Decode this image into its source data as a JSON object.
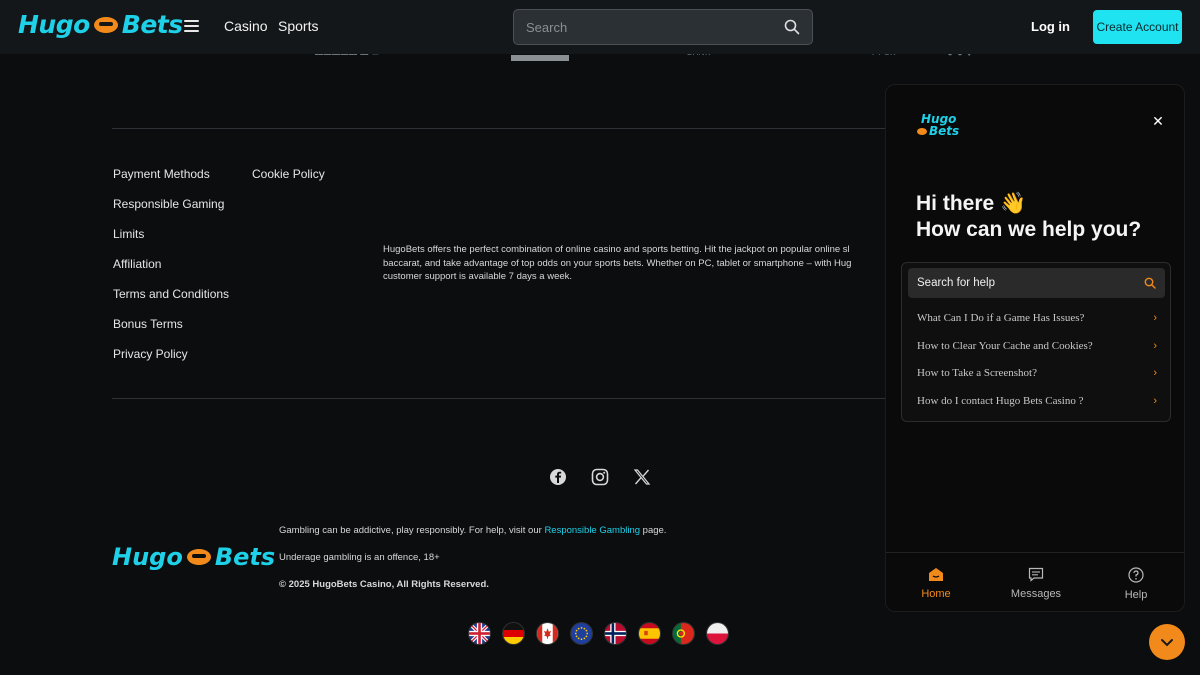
{
  "header": {
    "logo": {
      "part1": "Hugo",
      "part2": "Bets"
    },
    "nav": [
      "Casino",
      "Sports"
    ],
    "search_placeholder": "Search",
    "login_label": "Log in",
    "create_account_label": "Create Account"
  },
  "payment_fragments": [
    "BANK",
    "PSK"
  ],
  "footer": {
    "links_col1": [
      "Payment Methods",
      "Responsible Gaming",
      "Limits",
      "Affiliation",
      "Terms and Conditions",
      "Bonus Terms",
      "Privacy Policy"
    ],
    "links_col2": [
      "Cookie Policy"
    ],
    "about_lines": [
      "HugoBets offers the perfect combination of online casino and sports betting. Hit the jackpot on popular online sl",
      "baccarat, and take advantage of top odds on your sports bets. Whether on PC, tablet or smartphone – with Hug",
      "customer support is available 7 days a week."
    ],
    "legal": {
      "line1_prefix": "Gambling can be addictive, play responsibly. For help, visit our",
      "line1_link": "Responsible Gambling",
      "line1_suffix": "page.",
      "line2": "Underage gambling is an offence, 18+",
      "copyright": "© 2025 HugoBets Casino, All Rights Reserved."
    },
    "logo": {
      "part1": "Hugo",
      "part2": "Bets"
    },
    "social_icons": [
      "facebook-icon",
      "instagram-icon",
      "x-icon"
    ],
    "flags": [
      "uk-flag",
      "germany-flag",
      "canada-flag",
      "eu-flag",
      "norway-flag",
      "spain-flag",
      "portugal-flag",
      "poland-flag"
    ]
  },
  "widget": {
    "logo": {
      "part1": "Hugo",
      "part2": "Bets"
    },
    "greeting_line1": "Hi there 👋",
    "greeting_line2": "How can we help you?",
    "search_label": "Search for help",
    "articles": [
      "What Can I Do if a Game Has Issues?",
      "How to Clear Your Cache and Cookies?",
      "How to Take a Screenshot?",
      "How do I contact Hugo Bets Casino ?"
    ],
    "tabs": [
      "Home",
      "Messages",
      "Help"
    ],
    "active_tab": "Home"
  },
  "colors": {
    "brand": "#1fd1e8",
    "accent": "#f28a1b",
    "background": "#0b0d0f",
    "button": "#1fe3f0"
  }
}
